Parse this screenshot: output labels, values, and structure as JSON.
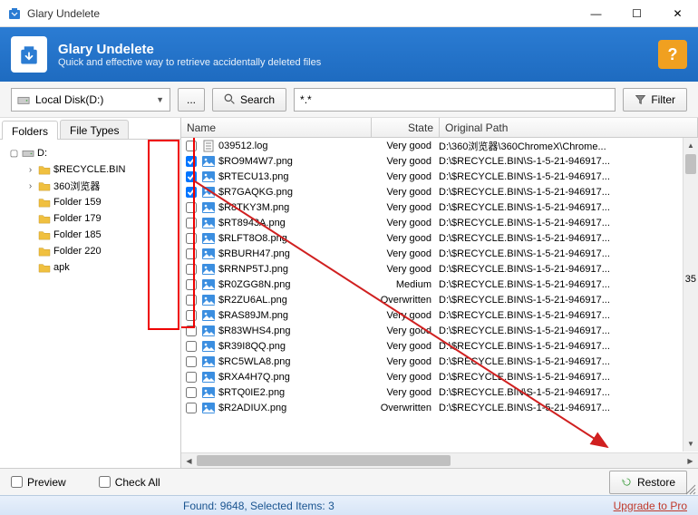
{
  "window": {
    "title": "Glary Undelete",
    "min": "—",
    "max": "☐",
    "close": "✕"
  },
  "header": {
    "title": "Glary Undelete",
    "subtitle": "Quick and effective way to retrieve accidentally deleted files"
  },
  "toolbar": {
    "drive": "Local Disk(D:)",
    "browse": "...",
    "search": "Search",
    "pattern": "*.*",
    "filter": "Filter"
  },
  "tabs": {
    "folders": "Folders",
    "filetypes": "File Types"
  },
  "tree": [
    {
      "indent": 0,
      "exp": "▢",
      "icon": "drive",
      "label": "D:"
    },
    {
      "indent": 1,
      "exp": "›",
      "icon": "folder",
      "label": "$RECYCLE.BIN"
    },
    {
      "indent": 1,
      "exp": "›",
      "icon": "folder",
      "label": "360浏览器"
    },
    {
      "indent": 1,
      "exp": "",
      "icon": "folder",
      "label": "Folder 159"
    },
    {
      "indent": 1,
      "exp": "",
      "icon": "folder",
      "label": "Folder 179"
    },
    {
      "indent": 1,
      "exp": "",
      "icon": "folder",
      "label": "Folder 185"
    },
    {
      "indent": 1,
      "exp": "",
      "icon": "folder",
      "label": "Folder 220"
    },
    {
      "indent": 1,
      "exp": "",
      "icon": "folder",
      "label": "apk"
    }
  ],
  "columns": {
    "name": "Name",
    "state": "State",
    "path": "Original Path"
  },
  "files": [
    {
      "chk": false,
      "name": "039512.log",
      "state": "Very good",
      "path": "D:\\360浏览器\\360ChromeX\\Chrome..."
    },
    {
      "chk": true,
      "name": "$RO9M4W7.png",
      "state": "Very good",
      "path": "D:\\$RECYCLE.BIN\\S-1-5-21-946917..."
    },
    {
      "chk": true,
      "name": "$RTECU13.png",
      "state": "Very good",
      "path": "D:\\$RECYCLE.BIN\\S-1-5-21-946917..."
    },
    {
      "chk": true,
      "name": "$R7GAQKG.png",
      "state": "Very good",
      "path": "D:\\$RECYCLE.BIN\\S-1-5-21-946917..."
    },
    {
      "chk": false,
      "name": "$R8TKY3M.png",
      "state": "Very good",
      "path": "D:\\$RECYCLE.BIN\\S-1-5-21-946917..."
    },
    {
      "chk": false,
      "name": "$RT8943A.png",
      "state": "Very good",
      "path": "D:\\$RECYCLE.BIN\\S-1-5-21-946917..."
    },
    {
      "chk": false,
      "name": "$RLFT8O8.png",
      "state": "Very good",
      "path": "D:\\$RECYCLE.BIN\\S-1-5-21-946917..."
    },
    {
      "chk": false,
      "name": "$RBURH47.png",
      "state": "Very good",
      "path": "D:\\$RECYCLE.BIN\\S-1-5-21-946917..."
    },
    {
      "chk": false,
      "name": "$RRNP5TJ.png",
      "state": "Very good",
      "path": "D:\\$RECYCLE.BIN\\S-1-5-21-946917..."
    },
    {
      "chk": false,
      "name": "$R0ZGG8N.png",
      "state": "Medium",
      "path": "D:\\$RECYCLE.BIN\\S-1-5-21-946917..."
    },
    {
      "chk": false,
      "name": "$R2ZU6AL.png",
      "state": "Overwritten",
      "path": "D:\\$RECYCLE.BIN\\S-1-5-21-946917..."
    },
    {
      "chk": false,
      "name": "$RAS89JM.png",
      "state": "Very good",
      "path": "D:\\$RECYCLE.BIN\\S-1-5-21-946917..."
    },
    {
      "chk": false,
      "name": "$R83WHS4.png",
      "state": "Very good",
      "path": "D:\\$RECYCLE.BIN\\S-1-5-21-946917..."
    },
    {
      "chk": false,
      "name": "$R39I8QQ.png",
      "state": "Very good",
      "path": "D:\\$RECYCLE.BIN\\S-1-5-21-946917..."
    },
    {
      "chk": false,
      "name": "$RC5WLA8.png",
      "state": "Very good",
      "path": "D:\\$RECYCLE.BIN\\S-1-5-21-946917..."
    },
    {
      "chk": false,
      "name": "$RXA4H7Q.png",
      "state": "Very good",
      "path": "D:\\$RECYCLE.BIN\\S-1-5-21-946917..."
    },
    {
      "chk": false,
      "name": "$RTQ0IE2.png",
      "state": "Very good",
      "path": "D:\\$RECYCLE.BIN\\S-1-5-21-946917..."
    },
    {
      "chk": false,
      "name": "$R2ADIUX.png",
      "state": "Overwritten",
      "path": "D:\\$RECYCLE.BIN\\S-1-5-21-946917..."
    }
  ],
  "footer": {
    "preview": "Preview",
    "checkall": "Check All",
    "restore": "Restore"
  },
  "status": {
    "found": "Found: 9648, Selected Items: 3",
    "upgrade": "Upgrade to Pro"
  },
  "extra": {
    "num35": "35"
  }
}
